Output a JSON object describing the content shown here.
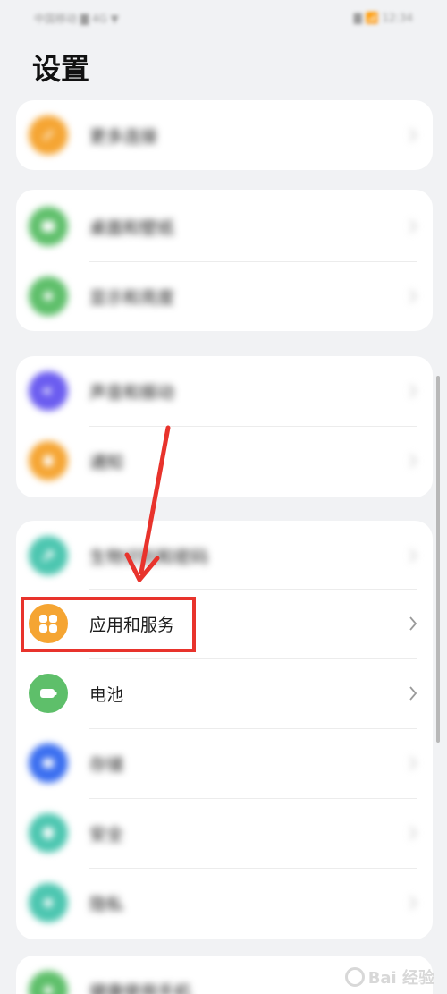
{
  "status_bar": {
    "left": "中国移动 ▇ 4G ▼",
    "right": "▇ 📶 12:34"
  },
  "page": {
    "title": "设置"
  },
  "sections": [
    {
      "rows": [
        {
          "label": "更多连接",
          "icon": "link-icon",
          "color": "#f5a533",
          "blurred": true
        }
      ]
    },
    {
      "rows": [
        {
          "label": "桌面和壁纸",
          "icon": "wallpaper-icon",
          "color": "#5ebf6a",
          "blurred": true
        },
        {
          "label": "显示和亮度",
          "icon": "display-icon",
          "color": "#5ebf6a",
          "blurred": true
        }
      ]
    },
    {
      "rows": [
        {
          "label": "声音和振动",
          "icon": "sound-icon",
          "color": "#6b5cf0",
          "blurred": true
        },
        {
          "label": "通知",
          "icon": "notification-icon",
          "color": "#f5a533",
          "blurred": true
        }
      ]
    },
    {
      "rows": [
        {
          "label": "生物识别和密码",
          "icon": "key-icon",
          "color": "#4cc6b0",
          "blurred": true
        },
        {
          "label": "应用和服务",
          "icon": "apps-icon",
          "color": "#f5a533",
          "blurred": false
        },
        {
          "label": "电池",
          "icon": "battery-icon",
          "color": "#5ebf6a",
          "blurred": false
        },
        {
          "label": "存储",
          "icon": "storage-icon",
          "color": "#3a6ef0",
          "blurred": true
        },
        {
          "label": "安全",
          "icon": "security-icon",
          "color": "#4cc6b0",
          "blurred": true
        },
        {
          "label": "隐私",
          "icon": "privacy-icon",
          "color": "#4cc6b0",
          "blurred": true
        }
      ]
    },
    {
      "rows": [
        {
          "label": "健康使用手机",
          "icon": "health-icon",
          "color": "#5ebf6a",
          "blurred": true
        }
      ]
    }
  ],
  "annotation": {
    "highlight_color": "#e8332c",
    "highlighted_item": "应用和服务"
  },
  "watermark": {
    "text": "Bai 经验"
  }
}
